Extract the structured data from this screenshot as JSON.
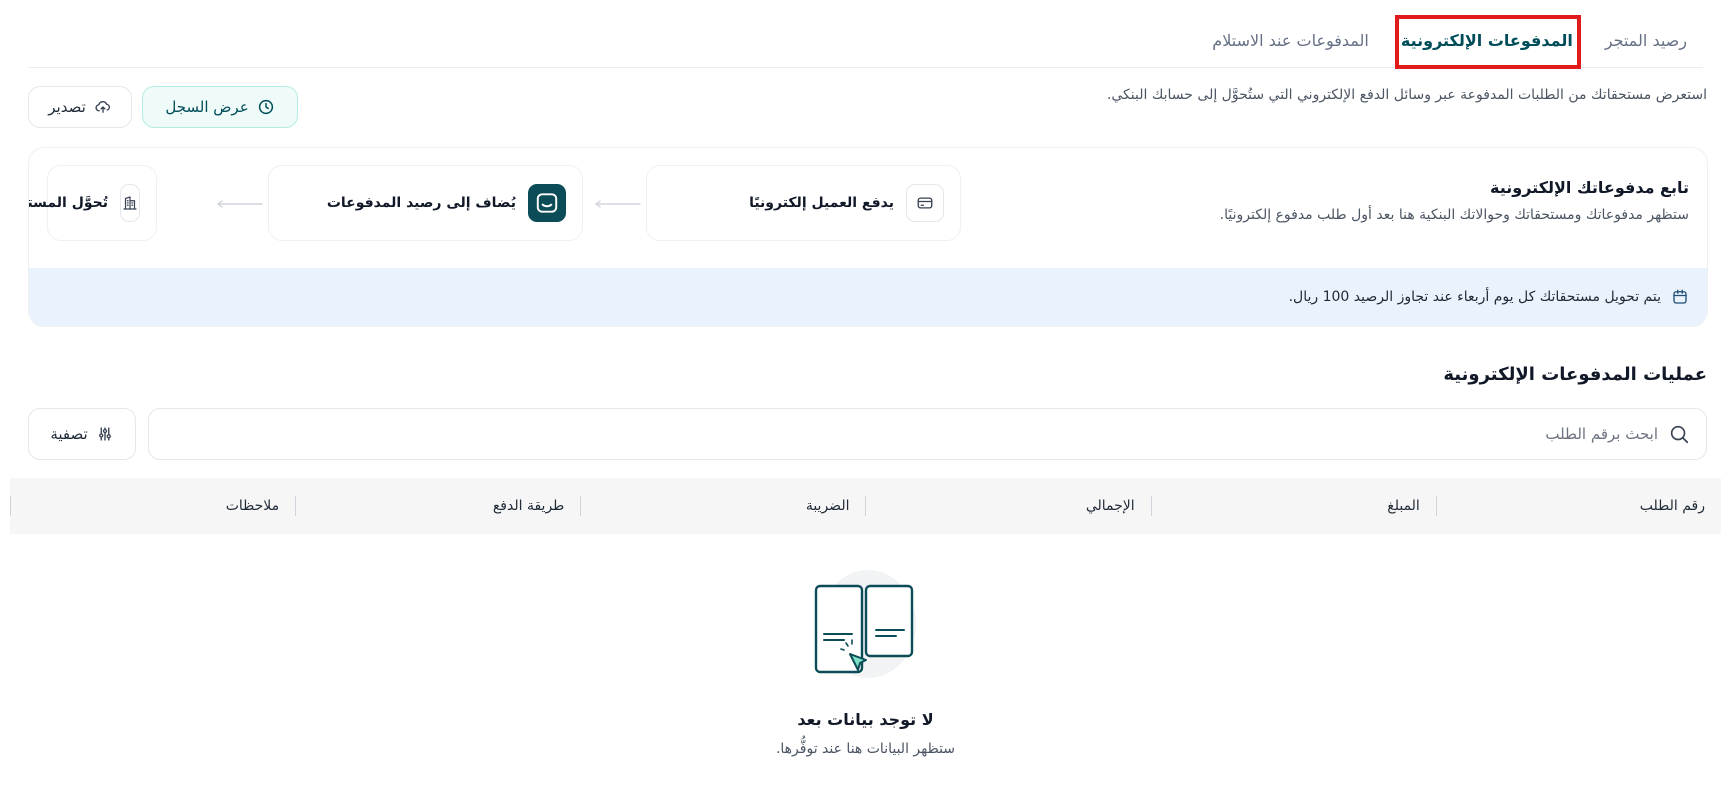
{
  "tabs": [
    {
      "label": "رصيد المتجر",
      "active": false
    },
    {
      "label": "المدفوعات الإلكترونية",
      "active": true
    },
    {
      "label": "المدفوعات عند الاستلام",
      "active": false
    }
  ],
  "header": {
    "description": "استعرض مستحقاتك من الطلبات المدفوعة عبر وسائل الدفع الإلكتروني التي ستُحوَّل إلى حسابك البنكي.",
    "history_button": "عرض السجل",
    "export_button": "تصدير"
  },
  "info_card": {
    "title": "تابع مدفوعاتك الإلكترونية",
    "subtitle": "ستظهر مدفوعاتك ومستحقاتك وحوالاتك البنكية هنا بعد أول طلب مدفوع إلكترونيًا.",
    "steps": [
      {
        "label": "يدفع العميل إلكترونيًا",
        "icon": "card-icon"
      },
      {
        "label": "يُضاف إلى رصيد المدفوعات",
        "icon": "brand-icon"
      },
      {
        "label": "تُحوَّل المستحقات إلى حسابك البنكي",
        "icon": "bank-icon"
      }
    ],
    "notice": "يتم تحويل مستحقاتك كل يوم أربعاء عند تجاوز الرصيد 100 ريال."
  },
  "transactions": {
    "title": "عمليات المدفوعات الإلكترونية",
    "search_placeholder": "ابحث برقم الطلب",
    "filter_button": "تصفية",
    "columns": [
      "رقم الطلب",
      "المبلغ",
      "الإجمالي",
      "الضريبة",
      "طريقة الدفع",
      "ملاحظات"
    ],
    "empty_title": "لا توجد بيانات بعد",
    "empty_subtitle": "ستظهر البيانات هنا عند توفُّرها."
  },
  "colors": {
    "brand": "#004d5a",
    "highlight": "#e01b1b",
    "notice_bg": "#eaf2fd"
  }
}
